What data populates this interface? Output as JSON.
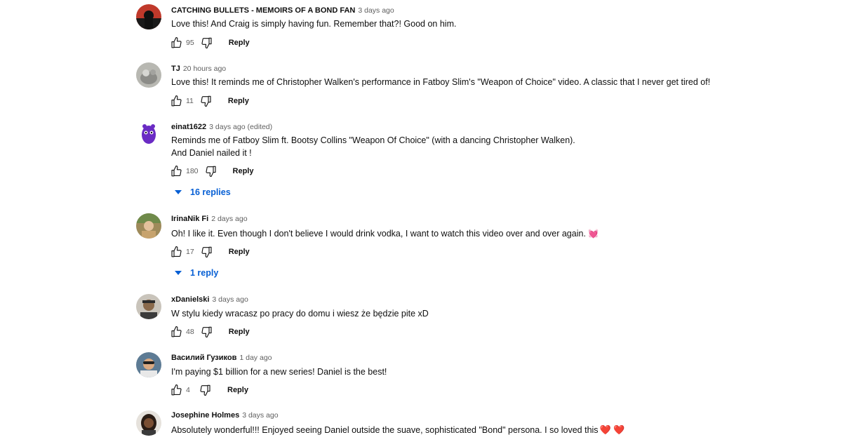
{
  "comments": [
    {
      "author": "CATCHING BULLETS - MEMOIRS OF A BOND FAN",
      "time": "3 days ago",
      "edited": "",
      "lines": [
        "Love this! And Craig is simply having fun. Remember that?! Good on him."
      ],
      "likes": "95",
      "reply_label": "Reply",
      "replies": ""
    },
    {
      "author": "TJ",
      "time": "20 hours ago",
      "edited": "",
      "lines": [
        "Love this! It reminds me of Christopher Walken's performance in Fatboy Slim's \"Weapon of Choice\" video. A classic that I never get tired of!"
      ],
      "likes": "11",
      "reply_label": "Reply",
      "replies": ""
    },
    {
      "author": "einat1622",
      "time": "3 days ago",
      "edited": "(edited)",
      "lines": [
        "Reminds me of Fatboy Slim ft. Bootsy Collins \"Weapon Of Choice\" (with a dancing Christopher Walken).",
        "And Daniel nailed it !"
      ],
      "likes": "180",
      "reply_label": "Reply",
      "replies": "16 replies"
    },
    {
      "author": "IrinaNik Fi",
      "time": "2 days ago",
      "edited": "",
      "lines": [
        "Oh! I like it. Even though I don't believe I would drink vodka, I want to watch this video over and over again. "
      ],
      "emoji": "💓",
      "likes": "17",
      "reply_label": "Reply",
      "replies": "1 reply"
    },
    {
      "author": "xDanielski",
      "time": "3 days ago",
      "edited": "",
      "lines": [
        "W stylu kiedy wracasz po pracy do domu i wiesz że będzie pite xD"
      ],
      "likes": "48",
      "reply_label": "Reply",
      "replies": ""
    },
    {
      "author": "Василий Гузиков",
      "time": "1 day ago",
      "edited": "",
      "lines": [
        "I'm paying $1 billion for a new series! Daniel is the best!"
      ],
      "likes": "4",
      "reply_label": "Reply",
      "replies": ""
    },
    {
      "author": "Josephine Holmes",
      "time": "3 days ago",
      "edited": "",
      "lines": [
        "Absolutely wonderful!!!  Enjoyed seeing Daniel outside the suave,  sophisticated \"Bond\" persona.  I so loved this"
      ],
      "emoji": "❤️ ❤️",
      "likes": "",
      "reply_label": "",
      "replies": ""
    }
  ],
  "colors": {
    "link_blue": "#065fd4",
    "secondary_text": "#606060",
    "primary_text": "#0f0f0f"
  },
  "icons": {
    "like": "thumbs-up-icon",
    "dislike": "thumbs-down-icon",
    "expand": "caret-down-icon"
  }
}
